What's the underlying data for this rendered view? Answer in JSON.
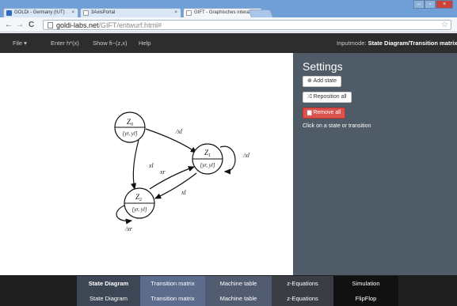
{
  "browser": {
    "tabs": [
      {
        "title": "GOLDi - Germany (IUT)",
        "close": "×",
        "color": "#2e6bbd"
      },
      {
        "title": "3AxisPortal",
        "close": "×",
        "color": "#ffffff"
      },
      {
        "title": "GIFT - Graphisches interakt",
        "close": "×",
        "color": "#ffffff"
      }
    ],
    "window_buttons": [
      "‒",
      "▫",
      "×"
    ],
    "nav": {
      "back": "←",
      "forward": "→",
      "reload": "C"
    },
    "url_host": "goldi-labs.net",
    "url_path": "/GIFT/entwurf.html#",
    "star": "☆"
  },
  "menu": {
    "file": "File ▾",
    "enter_h": "Enter h*(x)",
    "show_fi": "Show fi~(z,x)",
    "help": "Help",
    "inputmode_label": "Inputmode: ",
    "inputmode_value": "State Diagram/Transition matrix"
  },
  "diagram": {
    "states": [
      {
        "name": "Z",
        "sub": "0",
        "out": "[yr, yl]"
      },
      {
        "name": "Z",
        "sub": "1",
        "out": "[yr, yl]"
      },
      {
        "name": "Z",
        "sub": "2",
        "out": "[yr, yl]"
      }
    ],
    "transitions": {
      "t01": "/xl",
      "t11": "/xl",
      "t02": "xl",
      "t21": "xr",
      "t12": "xl",
      "t22": "/xr"
    }
  },
  "settings": {
    "title": "Settings",
    "add_state": "Add state",
    "reposition": "Reposition all",
    "remove": "Remove all",
    "hint": "Click on a state or transition"
  },
  "bottom_tabs": {
    "row1": [
      "State Diagram",
      "Transition matrix",
      "Machine table",
      "z-Equations",
      "Simulation"
    ],
    "row2": [
      "State Diagram",
      "Transition matrix",
      "Machine table",
      "z-Equations",
      "FlipFlop"
    ]
  },
  "colors": {
    "sidebar": "#4f5b66",
    "danger": "#d9534f",
    "navbar": "#2d2d2d"
  }
}
